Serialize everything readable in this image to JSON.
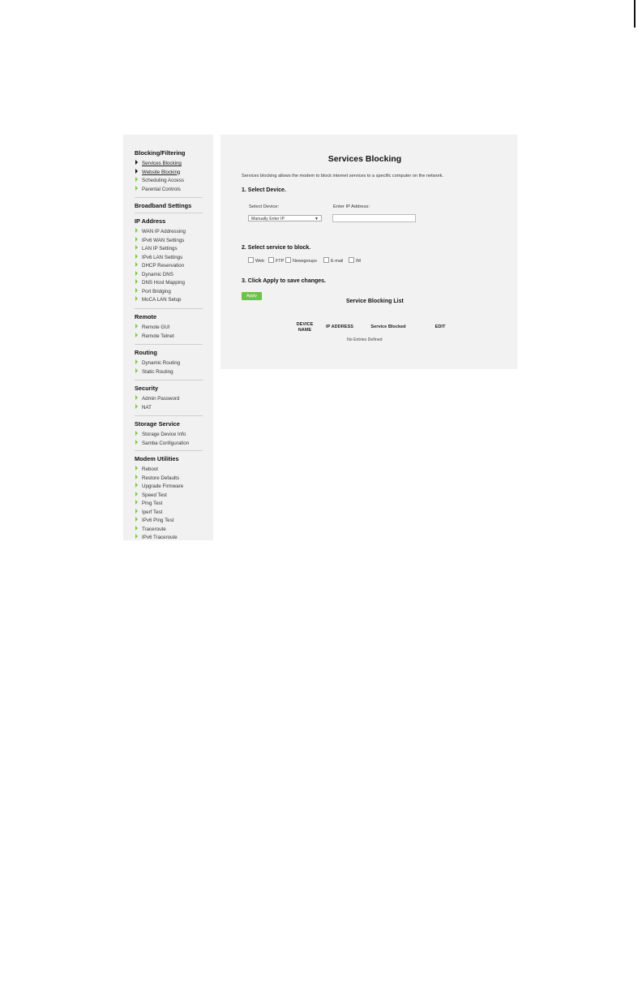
{
  "sidebar": {
    "groups": [
      {
        "title": "Blocking/Filtering",
        "items": [
          "Services Blocking",
          "Website Blocking",
          "Scheduling Access",
          "Parental Controls"
        ]
      },
      {
        "title": "Broadband Settings",
        "items": []
      },
      {
        "title": "IP Address",
        "items": [
          "WAN IP Addressing",
          "IPv6 WAN Settings",
          "LAN IP Settings",
          "IPv6 LAN Settings",
          "DHCP Reservation",
          "Dynamic DNS",
          "DNS Host Mapping",
          "Port Bridging",
          "MoCA LAN Setup"
        ]
      },
      {
        "title": "Remote",
        "items": [
          "Remote GUI",
          "Remote Telnet"
        ]
      },
      {
        "title": "Routing",
        "items": [
          "Dynamic Routing",
          "Static Routing"
        ]
      },
      {
        "title": "Security",
        "items": [
          "Admin Password",
          "NAT"
        ]
      },
      {
        "title": "Storage Service",
        "items": [
          "Storage Device Info",
          "Samba Configuration"
        ]
      },
      {
        "title": "Modem Utilities",
        "items": [
          "Reboot",
          "Restore Defaults",
          "Upgrade Firmware",
          "Speed Test",
          "Ping Test",
          "Iperf Test",
          "IPv6 Ping Test",
          "Traceroute",
          "IPv6 Traceroute"
        ]
      }
    ]
  },
  "main": {
    "title": "Services Blocking",
    "description": "Services blocking allows the modem to block internet services to a specific computer on the network.",
    "step1": "1. Select Device.",
    "select_device_label": "Select Device:",
    "select_device_value": "Manually Enter IP",
    "ip_label": "Enter IP Address:",
    "ip_value": "",
    "step2": "2. Select service to block.",
    "services": [
      "Web",
      "FTP",
      "Newsgroups",
      "E-mail",
      "IM"
    ],
    "step3": "3. Click Apply to save changes.",
    "apply_label": "Apply",
    "list_title": "Service Blocking List",
    "columns": [
      "DEVICE NAME",
      "IP ADDRESS",
      "Service Blocked",
      "EDIT"
    ],
    "empty_text": "No Entries Defined"
  },
  "colors": {
    "accent_green": "#6cc24a",
    "panel_bg": "#f2f2f2"
  }
}
